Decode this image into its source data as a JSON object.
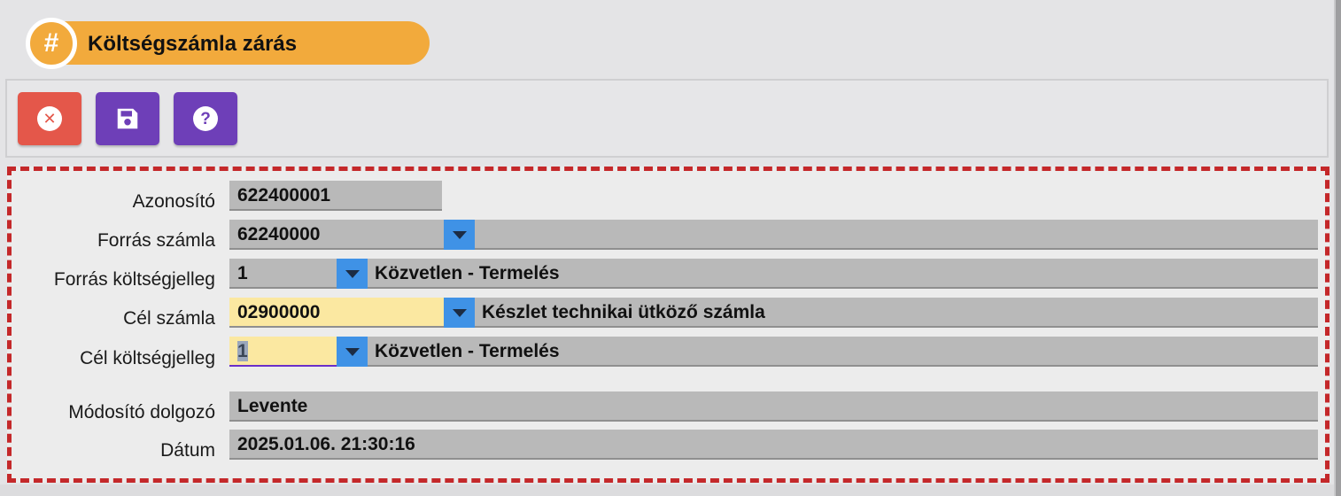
{
  "header": {
    "title": "Költségszámla zárás",
    "badge_icon": "hash-icon"
  },
  "toolbar": {
    "buttons": [
      {
        "name": "close",
        "icon": "close-icon",
        "color": "#e4574a"
      },
      {
        "name": "save",
        "icon": "save-icon",
        "color": "#6e3fb8"
      },
      {
        "name": "help",
        "icon": "help-icon",
        "color": "#6e3fb8"
      }
    ]
  },
  "form": {
    "azonosito": {
      "label": "Azonosító",
      "value": "622400001"
    },
    "forras_szamla": {
      "label": "Forrás számla",
      "value": "62240000",
      "description": ""
    },
    "forras_koltsegjelleg": {
      "label": "Forrás költségjelleg",
      "value": "1",
      "description": "Közvetlen - Termelés"
    },
    "cel_szamla": {
      "label": "Cél számla",
      "value": "02900000",
      "description": "Készlet technikai ütköző számla"
    },
    "cel_koltsegjelleg": {
      "label": "Cél költségjelleg",
      "value": "1",
      "description": "Közvetlen - Termelés"
    },
    "modosito_dolgozo": {
      "label": "Módosító dolgozó",
      "value": "Levente"
    },
    "datum": {
      "label": "Dátum",
      "value": "2025.01.06. 21:30:16"
    }
  },
  "colors": {
    "accent": "#f2aa3c",
    "danger": "#e4574a",
    "primary": "#6e3fb8",
    "dropdown": "#3f92e6",
    "highlight_field": "#fbe8a1",
    "panel_border": "#c4282a"
  }
}
